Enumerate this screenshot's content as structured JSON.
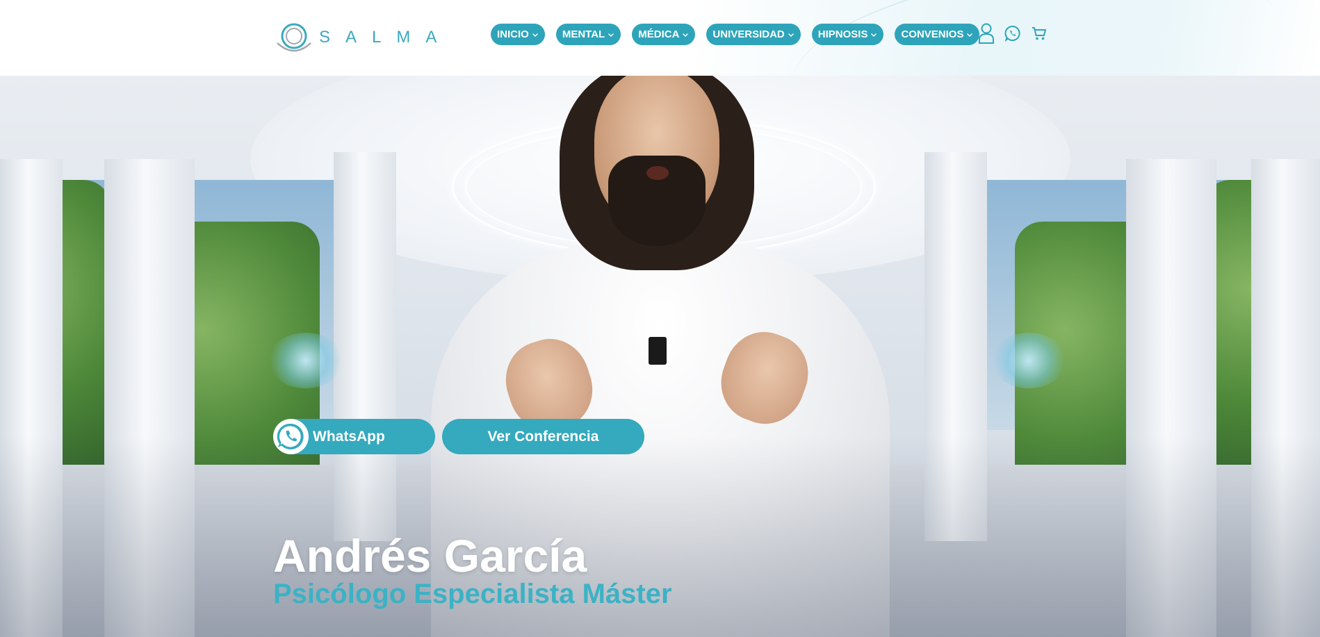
{
  "brand": {
    "logo_text": "SALMA",
    "accent_color": "#2da4ba"
  },
  "nav": {
    "items": [
      {
        "label": "INICIO",
        "icon": "chevron-down-icon"
      },
      {
        "label": "MENTAL",
        "icon": "chevron-down-icon"
      },
      {
        "label": "MÉDICA",
        "icon": "chevron-down-icon"
      },
      {
        "label": "UNIVERSIDAD",
        "icon": "chevron-down-icon"
      },
      {
        "label": "HIPNOSIS",
        "icon": "chevron-down-icon"
      },
      {
        "label": "CONVENIOS",
        "icon": "chevron-down-icon"
      }
    ]
  },
  "header_icons": {
    "account": "user-icon",
    "whatsapp": "whatsapp-icon",
    "cart": "shopping-cart-icon"
  },
  "hero": {
    "cta_whatsapp": "WhatsApp",
    "cta_conference": "Ver Conferencia",
    "name": "Andrés García",
    "subtitle": "Psicólogo Especialista Máster",
    "name_color": "#ffffff",
    "subtitle_color": "#3bb2c5"
  }
}
